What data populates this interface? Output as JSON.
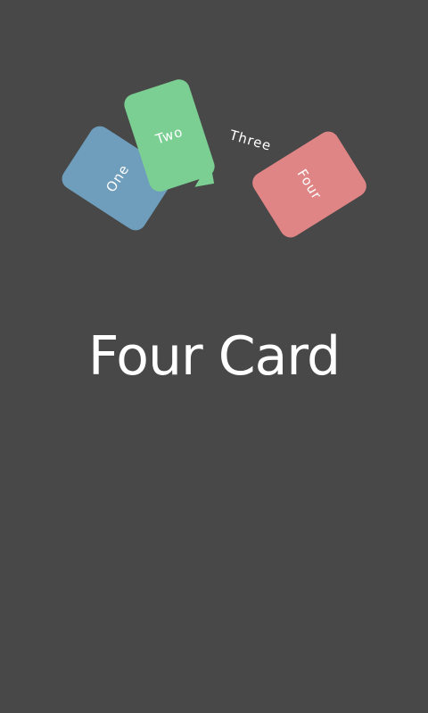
{
  "logo": {
    "cards": [
      {
        "label": "One",
        "color": "#6f9ebd"
      },
      {
        "label": "Two",
        "color": "#7bcf93"
      },
      {
        "label": "Three",
        "color": "#ffffff"
      },
      {
        "label": "Four",
        "color": "#e08585"
      }
    ]
  },
  "app": {
    "title": "Four Card",
    "background": "#484848"
  }
}
